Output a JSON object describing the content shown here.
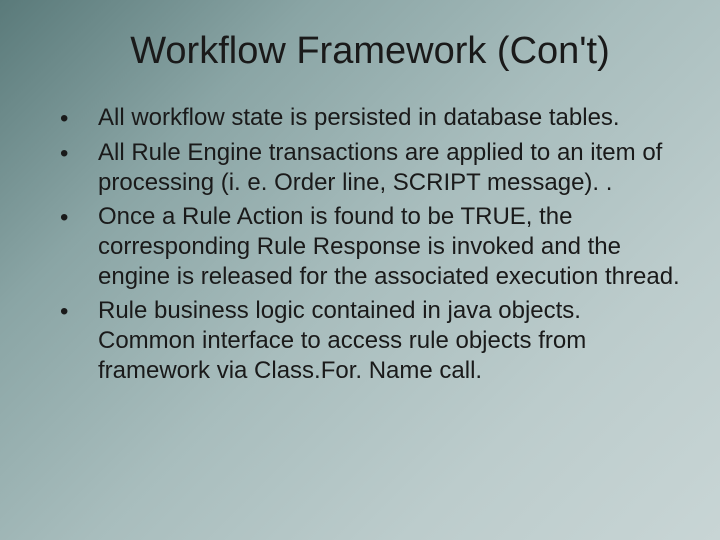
{
  "title": "Workflow Framework (Con't)",
  "bullets": [
    "All workflow state is persisted in database tables.",
    "All Rule Engine transactions are applied to an item of processing (i. e. Order line, SCRIPT message). .",
    "Once a Rule Action is found to be TRUE, the corresponding Rule Response is invoked and the engine is released for the associated execution thread.",
    "Rule business logic contained in java objects. Common interface to access rule objects from framework via Class.For. Name call."
  ]
}
